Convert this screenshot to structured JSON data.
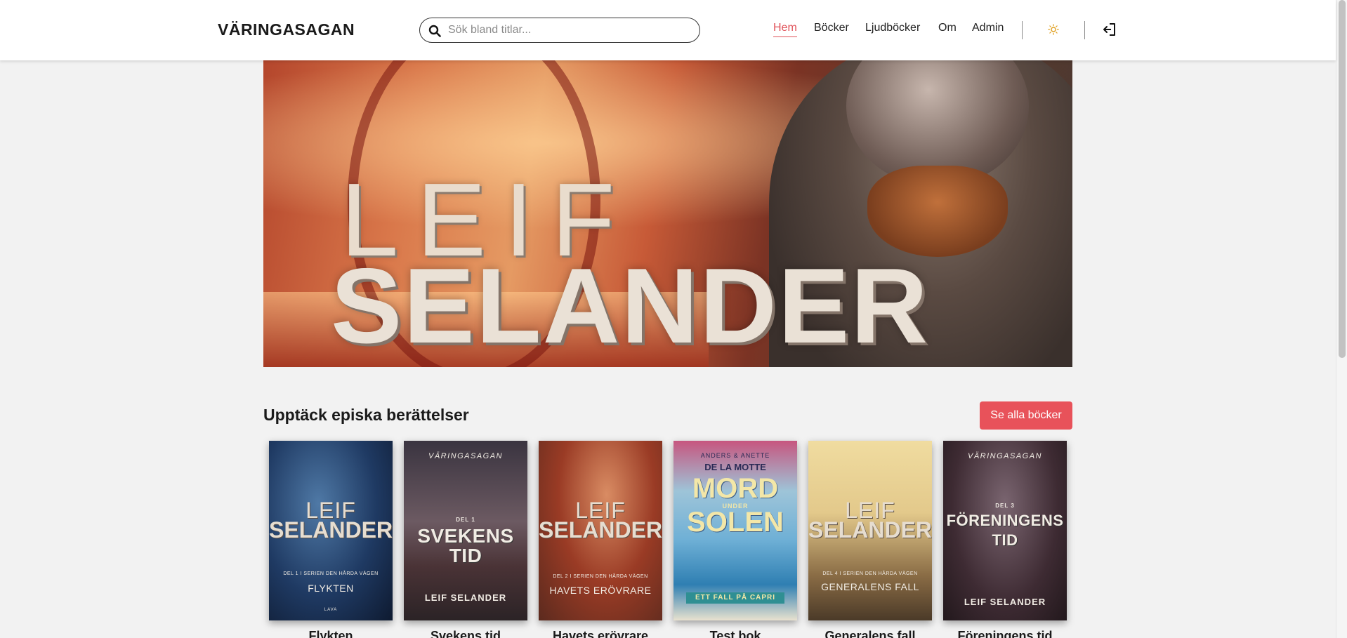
{
  "header": {
    "brand": "VÄRINGASAGAN",
    "search_placeholder": "Sök bland titlar...",
    "nav": {
      "home": "Hem",
      "books": "Böcker",
      "audiobooks": "Ljudböcker",
      "about": "Om",
      "admin": "Admin"
    },
    "icons": [
      "search-icon",
      "sun-icon",
      "logout-icon"
    ]
  },
  "hero": {
    "line1": "LEIF",
    "line2": "SELANDER"
  },
  "section": {
    "title": "Upptäck episka berättelser",
    "see_all": "Se alla böcker"
  },
  "books": [
    {
      "title": "Flykten",
      "cover": {
        "author_first": "LEIF",
        "author_last": "SELANDER",
        "series_line": "DEL 1 I SERIEN DEN HÅRDA VÄGEN",
        "subtitle": "FLYKTEN",
        "publisher": "LAVA"
      }
    },
    {
      "title": "Svekens tid",
      "cover": {
        "series": "VÄRINGASAGAN",
        "part": "DEL 1",
        "big_title": "SVEKENS TID",
        "author": "LEIF SELANDER"
      }
    },
    {
      "title": "Havets erövrare",
      "cover": {
        "author_first": "LEIF",
        "author_last": "SELANDER",
        "series_line": "DEL 2 I SERIEN DEN HÅRDA VÄGEN",
        "subtitle": "HAVETS ERÖVRARE"
      }
    },
    {
      "title": "Test bok",
      "cover": {
        "author_top": "ANDERS & ANETTE",
        "author_name": "DE LA MOTTE",
        "title_1": "MORD",
        "under": "UNDER",
        "title_2": "SOLEN",
        "band": "ETT FALL PÅ CAPRI"
      }
    },
    {
      "title": "Generalens fall",
      "cover": {
        "author_first": "LEIF",
        "author_last": "SELANDER",
        "series_line": "DEL 4 I SERIEN DEN HÅRDA VÄGEN",
        "subtitle": "GENERALENS FALL"
      }
    },
    {
      "title": "Föreningens tid",
      "cover": {
        "series": "VÄRINGASAGAN",
        "part": "DEL 3",
        "big_title": "FÖRENINGENS TID",
        "author": "LEIF SELANDER"
      }
    }
  ],
  "colors": {
    "accent": "#e8525a",
    "active_nav": "#e05259",
    "header_bg": "#ffffff",
    "page_bg": "#f2f2f2"
  }
}
